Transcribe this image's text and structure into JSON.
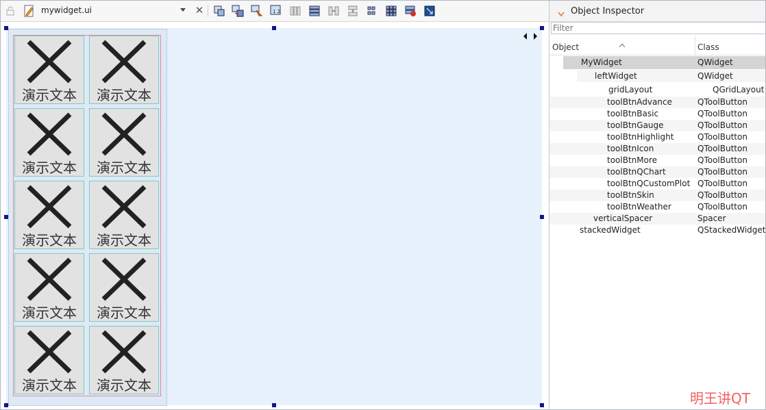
{
  "toolbar": {
    "file_name": "mywidget.ui",
    "icons": [
      "lock-icon",
      "file-edit-icon",
      "dropdown-arrow-icon",
      "close-icon",
      "edit-widgets-icon",
      "edit-signals-slots-icon",
      "edit-buddies-icon",
      "edit-tab-order-icon",
      "layout-horizontal-icon",
      "layout-vertical-icon",
      "layout-splitter-horizontal-icon",
      "layout-splitter-vertical-icon",
      "layout-form-icon",
      "layout-grid-icon",
      "break-layout-icon",
      "adjust-size-icon"
    ]
  },
  "canvas": {
    "tool_button_label": "演示文本",
    "tool_buttons": [
      {
        "label": "演示文本"
      },
      {
        "label": "演示文本"
      },
      {
        "label": "演示文本"
      },
      {
        "label": "演示文本"
      },
      {
        "label": "演示文本"
      },
      {
        "label": "演示文本"
      },
      {
        "label": "演示文本"
      },
      {
        "label": "演示文本"
      },
      {
        "label": "演示文本"
      },
      {
        "label": "演示文本"
      }
    ]
  },
  "inspector": {
    "title": "Object Inspector",
    "filter_placeholder": "Filter",
    "col_object": "Object",
    "col_class": "Class",
    "rows": [
      {
        "object": "MyWidget",
        "class": "QWidget"
      },
      {
        "object": "leftWidget",
        "class": "QWidget"
      },
      {
        "object": "gridLayout",
        "class": "QGridLayout"
      },
      {
        "object": "toolBtnAdvance",
        "class": "QToolButton"
      },
      {
        "object": "toolBtnBasic",
        "class": "QToolButton"
      },
      {
        "object": "toolBtnGauge",
        "class": "QToolButton"
      },
      {
        "object": "toolBtnHighlight",
        "class": "QToolButton"
      },
      {
        "object": "toolBtnIcon",
        "class": "QToolButton"
      },
      {
        "object": "toolBtnMore",
        "class": "QToolButton"
      },
      {
        "object": "toolBtnQChart",
        "class": "QToolButton"
      },
      {
        "object": "toolBtnQCustomPlot",
        "class": "QToolButton"
      },
      {
        "object": "toolBtnSkin",
        "class": "QToolButton"
      },
      {
        "object": "toolBtnWeather",
        "class": "QToolButton"
      },
      {
        "object": "verticalSpacer",
        "class": "Spacer"
      },
      {
        "object": "stackedWidget",
        "class": "QStackedWidget"
      }
    ]
  },
  "watermark": "明王讲QT",
  "colors": {
    "canvas_bg": "#e7f2fd",
    "accent_orange": "#e07b39",
    "selection_handle": "#101888",
    "watermark": "#f26060"
  }
}
